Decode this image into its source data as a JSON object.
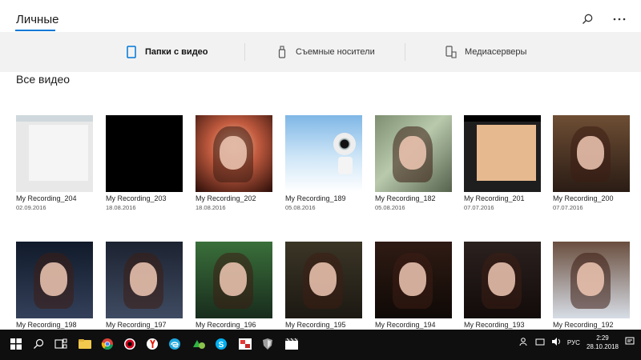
{
  "app": {
    "title": "Личные",
    "search_icon": "search-icon",
    "more_icon": "more-icon"
  },
  "tabs": [
    {
      "label": "Папки с видео",
      "icon": "tablet-icon",
      "active": true
    },
    {
      "label": "Съемные носители",
      "icon": "usb-icon",
      "active": false
    },
    {
      "label": "Медиасерверы",
      "icon": "media-server-icon",
      "active": false
    }
  ],
  "main": {
    "section_title": "Все видео",
    "videos": [
      {
        "name": "My Recording_204",
        "date": "02.09.2016",
        "thumb": "t-app"
      },
      {
        "name": "My Recording_203",
        "date": "18.08.2016",
        "thumb": "t-black"
      },
      {
        "name": "My Recording_202",
        "date": "18.08.2016",
        "thumb": "t-party"
      },
      {
        "name": "My Recording_189",
        "date": "05.08.2016",
        "thumb": "t-cam"
      },
      {
        "name": "My Recording_182",
        "date": "05.08.2016",
        "thumb": "t-window"
      },
      {
        "name": "My Recording_201",
        "date": "07.07.2016",
        "thumb": "t-app2"
      },
      {
        "name": "My Recording_200",
        "date": "07.07.2016",
        "thumb": "t-girl"
      },
      {
        "name": "My Recording_198",
        "date": "",
        "thumb": "t-g1"
      },
      {
        "name": "My Recording_197",
        "date": "",
        "thumb": "t-g2"
      },
      {
        "name": "My Recording_196",
        "date": "",
        "thumb": "t-g3"
      },
      {
        "name": "My Recording_195",
        "date": "",
        "thumb": "t-g4"
      },
      {
        "name": "My Recording_194",
        "date": "",
        "thumb": "t-g5"
      },
      {
        "name": "My Recording_193",
        "date": "",
        "thumb": "t-g6"
      },
      {
        "name": "My Recording_192",
        "date": "",
        "thumb": "t-g7"
      }
    ]
  },
  "taskbar": {
    "apps": [
      "windows-start-icon",
      "search-icon",
      "task-view-icon",
      "file-explorer-icon",
      "chrome-icon",
      "opera-icon",
      "yandex-browser-icon",
      "edge-icon",
      "skype-icon",
      "paint-icon",
      "security-icon",
      "video-editor-icon"
    ],
    "tray": {
      "language": "РУС",
      "time": "2:29",
      "date": "28.10.2018"
    }
  },
  "colors": {
    "accent": "#0078d7",
    "tabs_bg": "#f2f2f2",
    "taskbar_bg": "#0f0f10"
  }
}
